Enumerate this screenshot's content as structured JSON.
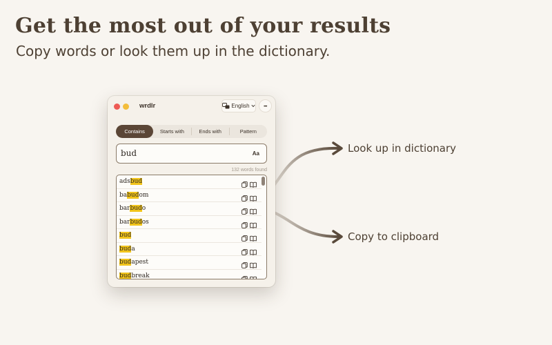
{
  "headline": "Get the most out of your results",
  "subline": "Copy words or look them up in the dictionary.",
  "app": {
    "title": "wrdlr",
    "language": "English",
    "more": "•••",
    "tabs": [
      {
        "label": "Contains",
        "active": true
      },
      {
        "label": "Starts with",
        "active": false
      },
      {
        "label": "Ends with",
        "active": false
      },
      {
        "label": "Pattern",
        "active": false
      }
    ],
    "search": {
      "value": "bud",
      "case_label": "Aa"
    },
    "count": "132 words found",
    "words": [
      {
        "pre": "ads",
        "match": "bud",
        "post": ""
      },
      {
        "pre": "ba",
        "match": "bud",
        "post": "om"
      },
      {
        "pre": "bar",
        "match": "bud",
        "post": "o"
      },
      {
        "pre": "bar",
        "match": "bud",
        "post": "os"
      },
      {
        "pre": "",
        "match": "bud",
        "post": ""
      },
      {
        "pre": "",
        "match": "bud",
        "post": "a"
      },
      {
        "pre": "",
        "match": "bud",
        "post": "apest"
      },
      {
        "pre": "",
        "match": "bud",
        "post": "break"
      }
    ]
  },
  "callouts": {
    "lookup": "Look up in dictionary",
    "copy": "Copy to clipboard"
  },
  "colors": {
    "background": "#f8f5f0",
    "accent": "#5b4636",
    "highlight": "#f1c41b",
    "text": "#4d4033"
  },
  "icons": [
    "copy-icon",
    "book-icon",
    "globe-icon",
    "arrow-right-icon"
  ]
}
